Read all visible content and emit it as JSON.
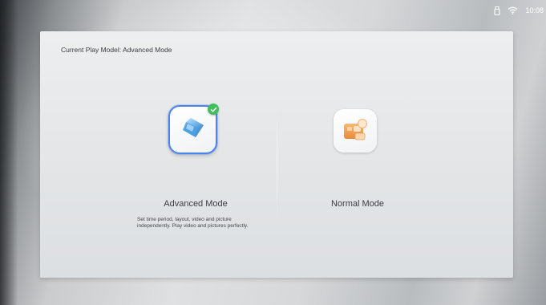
{
  "status_bar": {
    "time": "10:08",
    "icons": [
      "usb-icon",
      "wifi-icon"
    ]
  },
  "panel": {
    "title": "Current Play Model: Advanced Mode"
  },
  "modes": [
    {
      "label": "Advanced Mode",
      "description": "Set time period, layout, video and picture independently. Play video and pictures perfectly.",
      "icon": "advanced-mode-icon",
      "selected": true
    },
    {
      "label": "Normal Mode",
      "icon": "normal-mode-icon",
      "selected": false
    }
  ],
  "colors": {
    "selection_border": "#4a84ee",
    "check_badge": "#3fbf5e",
    "advanced_icon": "#5aa9e6",
    "normal_icon": "#f0a45a"
  }
}
